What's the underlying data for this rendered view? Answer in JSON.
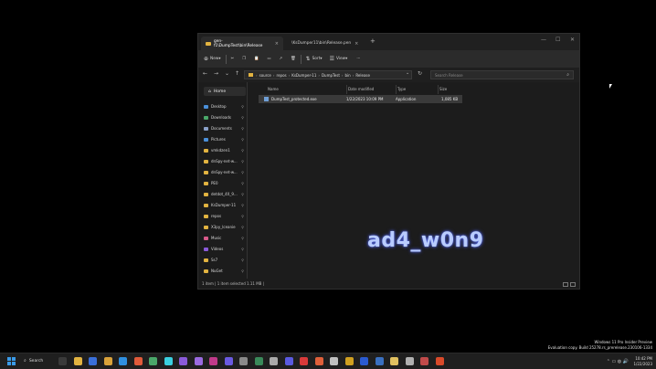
{
  "tabs": [
    {
      "label": "gen-f1\\DumpTest\\bin\\Release",
      "active": true
    },
    {
      "label": "\\KsDumper11\\bin\\Release.pen",
      "active": false
    }
  ],
  "cmdbar": {
    "new": "New",
    "sort": "Sort",
    "view": "View",
    "more": "···"
  },
  "address": [
    "source",
    "repos",
    "KsDumper-11",
    "DumpTest",
    "bin",
    "Release"
  ],
  "search_placeholder": "Search Release",
  "sidebar": {
    "home": "Home",
    "items": [
      {
        "label": "Desktop",
        "color": "#4a8fd9"
      },
      {
        "label": "Downloads",
        "color": "#4aa86a"
      },
      {
        "label": "Documents",
        "color": "#8aa0c8"
      },
      {
        "label": "Pictures",
        "color": "#4a8fd9"
      },
      {
        "label": "vmkdzen1",
        "color": "#e2b340"
      },
      {
        "label": "dnSpy-net-w...",
        "color": "#e2b340"
      },
      {
        "label": "dnSpy-net-w...",
        "color": "#e2b340"
      },
      {
        "label": "PE0",
        "color": "#e2b340"
      },
      {
        "label": "detdot_4X_9...",
        "color": "#e2b340"
      },
      {
        "label": "KsDumper-11",
        "color": "#e2b340"
      },
      {
        "label": "repos",
        "color": "#e2b340"
      },
      {
        "label": "X3py_Iceanie",
        "color": "#e2b340"
      },
      {
        "label": "Music",
        "color": "#d95a8a"
      },
      {
        "label": "Videos",
        "color": "#8a5ad9"
      },
      {
        "label": "Ss7",
        "color": "#e2b340"
      },
      {
        "label": "NuGet",
        "color": "#e2b340"
      }
    ]
  },
  "columns": {
    "name": "Name",
    "date": "Date modified",
    "type": "Type",
    "size": "Size"
  },
  "files": [
    {
      "name": "DumpTest_protected.exe",
      "date": "1/22/2023 10:09 PM",
      "type": "Application",
      "size": "1,085 KB"
    }
  ],
  "status": "1 item  |  1 item selected  1.11 MB  |",
  "overlay_text": "ad4_w0n9",
  "windows_watermark": [
    "Windows 11 Pro Insider Preview",
    "Evaluation copy. Build 25278.rs_prerelease.230106-1334"
  ],
  "taskbar": {
    "search": "Search"
  },
  "clock": {
    "time": "10:42 PM",
    "date": "1/22/2023"
  }
}
